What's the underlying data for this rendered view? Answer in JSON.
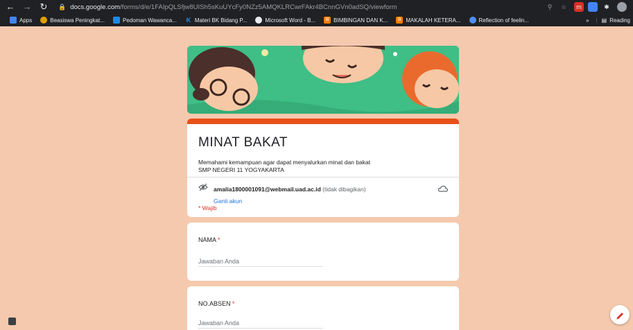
{
  "browser": {
    "url_host": "docs.google.com",
    "url_path": "/forms/d/e/1FAIpQLSfjw8UISh5sKuUYcFy0NZz5AMQKLRCwrFAkr4BCnnGVn0adSQ/viewform",
    "bookmarks": [
      {
        "label": "Apps",
        "icon": "apps-grid-icon",
        "color": "#4285f4"
      },
      {
        "label": "Beasiswa Peningkat...",
        "icon": "emblem-icon",
        "color": "#e0a100"
      },
      {
        "label": "Pedoman Wawanca...",
        "icon": "doc-icon",
        "color": "#1e88e5"
      },
      {
        "label": "Materi BK Bidang P...",
        "icon": "k-icon",
        "color": "#2b8cdc"
      },
      {
        "label": "Microsoft Word - B...",
        "icon": "chrome-icon",
        "color": "#e8eaed"
      },
      {
        "label": "BIMBINGAN DAN K...",
        "icon": "blogger-icon",
        "color": "#f57c00"
      },
      {
        "label": "MAKALAH KETERA...",
        "icon": "blogger-icon",
        "color": "#f57c00"
      },
      {
        "label": "Reflection of feelin...",
        "icon": "globe-icon",
        "color": "#4f8ef7"
      }
    ],
    "reading_list": "Reading"
  },
  "form": {
    "title": "MINAT BAKAT",
    "description_line1": "Memahami kemampuan agar dapat menyalurkan minat dan bakat",
    "description_line2": "SMP NEGERI 11 YOGYAKARTA",
    "account_email": "amalia1800001091@webmail.uad.ac.id",
    "account_note": "(tidak dibagikan)",
    "switch_account": "Ganti akun",
    "required_note": "* Wajib",
    "accent_color": "#e8501a",
    "questions": [
      {
        "label": "NAMA",
        "required": "*",
        "placeholder": "Jawaban Anda"
      },
      {
        "label": "NO.ABSEN",
        "required": "*",
        "placeholder": "Jawaban Anda"
      }
    ]
  }
}
